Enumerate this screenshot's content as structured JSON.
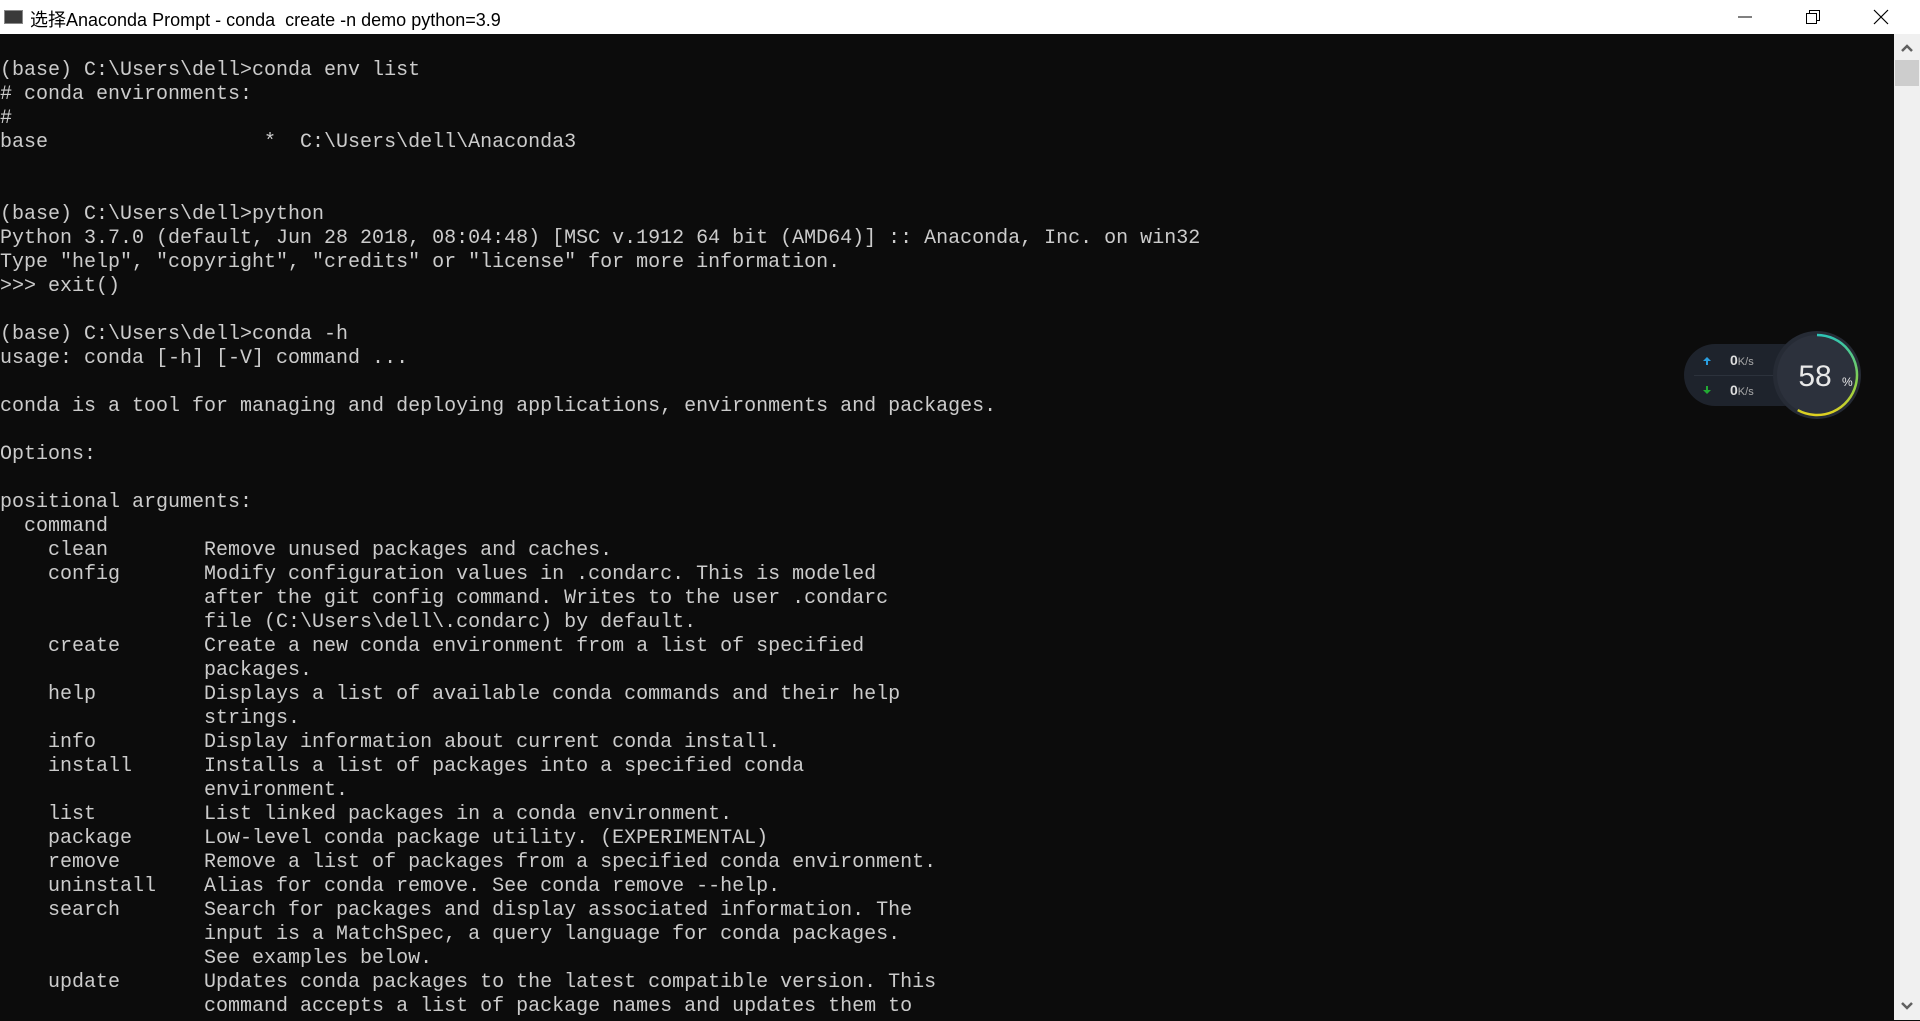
{
  "window": {
    "title": "选择Anaconda Prompt - conda  create -n demo python=3.9",
    "controls": [
      "minimize-icon",
      "restore-icon",
      "close-icon"
    ]
  },
  "terminal": {
    "text_color": "#cccccc",
    "background": "#0c0c0c",
    "lines": [
      "(base) C:\\Users\\dell>conda env list",
      "# conda environments:",
      "#",
      "base                  *  C:\\Users\\dell\\Anaconda3",
      "",
      "",
      "(base) C:\\Users\\dell>python",
      "Python 3.7.0 (default, Jun 28 2018, 08:04:48) [MSC v.1912 64 bit (AMD64)] :: Anaconda, Inc. on win32",
      "Type \"help\", \"copyright\", \"credits\" or \"license\" for more information.",
      ">>> exit()",
      "",
      "(base) C:\\Users\\dell>conda -h",
      "usage: conda [-h] [-V] command ...",
      "",
      "conda is a tool for managing and deploying applications, environments and packages.",
      "",
      "Options:",
      "",
      "positional arguments:",
      "  command",
      "    clean        Remove unused packages and caches.",
      "    config       Modify configuration values in .condarc. This is modeled",
      "                 after the git config command. Writes to the user .condarc",
      "                 file (C:\\Users\\dell\\.condarc) by default.",
      "    create       Create a new conda environment from a list of specified",
      "                 packages.",
      "    help         Displays a list of available conda commands and their help",
      "                 strings.",
      "    info         Display information about current conda install.",
      "    install      Installs a list of packages into a specified conda",
      "                 environment.",
      "    list         List linked packages in a conda environment.",
      "    package      Low-level conda package utility. (EXPERIMENTAL)",
      "    remove       Remove a list of packages from a specified conda environment.",
      "    uninstall    Alias for conda remove. See conda remove --help.",
      "    search       Search for packages and display associated information. The",
      "                 input is a MatchSpec, a query language for conda packages.",
      "                 See examples below.",
      "    update       Updates conda packages to the latest compatible version. This",
      "                 command accepts a list of package names and updates them to"
    ]
  },
  "net_widget": {
    "upload_value": "0",
    "upload_unit": "K/s",
    "download_value": "0",
    "download_unit": "K/s",
    "percent_value": "58",
    "percent_sign": "%",
    "percent": 58,
    "upload_color": "#2a9fe0",
    "download_color": "#22aa33"
  }
}
